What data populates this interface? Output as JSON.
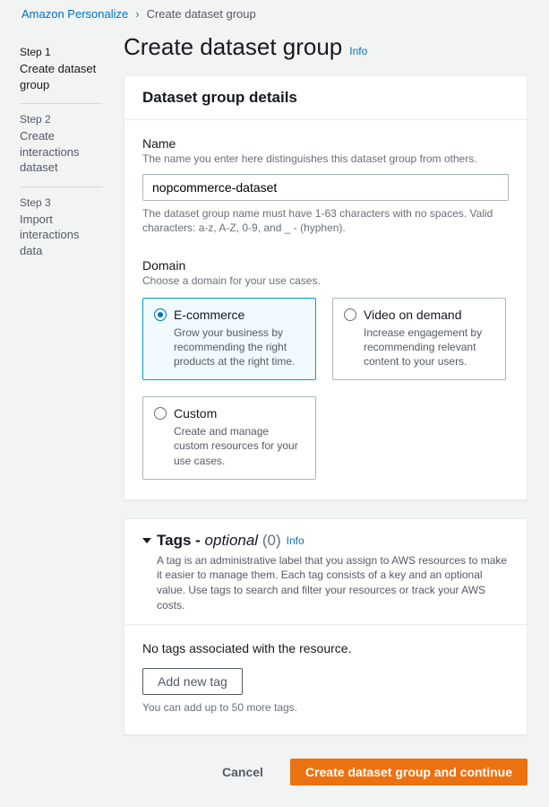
{
  "breadcrumb": {
    "service": "Amazon Personalize",
    "current": "Create dataset group"
  },
  "sidebar": {
    "steps": [
      {
        "label": "Step 1",
        "title": "Create dataset group"
      },
      {
        "label": "Step 2",
        "title": "Create interactions dataset"
      },
      {
        "label": "Step 3",
        "title": "Import interactions data"
      }
    ]
  },
  "page": {
    "title": "Create dataset group",
    "info": "Info"
  },
  "details": {
    "panel_title": "Dataset group details",
    "name": {
      "label": "Name",
      "desc": "The name you enter here distinguishes this dataset group from others.",
      "value": "nopcommerce-dataset",
      "hint": "The dataset group name must have 1-63 characters with no spaces. Valid characters: a-z, A-Z, 0-9, and _ - (hyphen)."
    },
    "domain": {
      "label": "Domain",
      "desc": "Choose a domain for your use cases.",
      "options": [
        {
          "title": "E-commerce",
          "desc": "Grow your business by recommending the right products at the right time.",
          "selected": true
        },
        {
          "title": "Video on demand",
          "desc": "Increase engagement by recommending relevant content to your users.",
          "selected": false
        },
        {
          "title": "Custom",
          "desc": "Create and manage custom resources for your use cases.",
          "selected": false
        }
      ]
    }
  },
  "tags": {
    "title_prefix": "Tags - ",
    "title_optional": "optional",
    "count_display": "(0)",
    "info": "Info",
    "desc": "A tag is an administrative label that you assign to AWS resources to make it easier to manage them. Each tag consists of a key and an optional value. Use tags to search and filter your resources or track your AWS costs.",
    "empty": "No tags associated with the resource.",
    "add_button": "Add new tag",
    "limit_hint": "You can add up to 50 more tags."
  },
  "footer": {
    "cancel": "Cancel",
    "submit": "Create dataset group and continue"
  }
}
